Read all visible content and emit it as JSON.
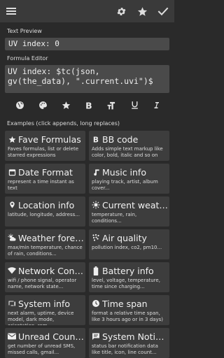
{
  "toolbar": {
    "menu": "hamburger-icon",
    "settings": "gear-icon",
    "favorite": "star-icon",
    "confirm": "check-icon"
  },
  "text_preview": {
    "label": "Text Preview",
    "value": "UV index: 0"
  },
  "formula_editor": {
    "label": "Formula Editor",
    "value": "UV index: $tc(json, gv(the_data), \".current.uvi\")$"
  },
  "editor_tools": [
    "globe-icon",
    "palette-icon",
    "star-icon",
    "bold-icon",
    "text-size-icon",
    "underline-icon",
    "italic-icon"
  ],
  "examples": {
    "label": "Examples",
    "hint": "(click appends, long replaces)",
    "cards": [
      {
        "title": "Fave Formulas",
        "desc": "Faves formulas, list or delete starred expressions",
        "icon": "star-icon"
      },
      {
        "title": "BB code",
        "desc": "Adds simple text markup like color, bold, italic and so on",
        "icon": "bold-icon"
      },
      {
        "title": "Date Format",
        "desc": "represent a time instant as text",
        "icon": "calendar-icon"
      },
      {
        "title": "Music info",
        "desc": "playing track, artist, album cover...",
        "icon": "music-note-icon"
      },
      {
        "title": "Location info",
        "desc": "latitude, longitude, address...",
        "icon": "location-pin-icon"
      },
      {
        "title": "Current weather",
        "desc": "temperature, rain, conditions...",
        "icon": "sun-icon"
      },
      {
        "title": "Weather forec...",
        "desc": "max/min temperature, chance of rain, conditions...",
        "icon": "weather-icon"
      },
      {
        "title": "Air quality",
        "desc": "pollution index, co2, pm10...",
        "icon": "air-quality-icon"
      },
      {
        "title": "Network Conn...",
        "desc": "wifi / phone signal, operator name, network state...",
        "icon": "wifi-icon"
      },
      {
        "title": "Battery info",
        "desc": "level, voltage, temperature, time since charging...",
        "icon": "battery-icon"
      },
      {
        "title": "System info",
        "desc": "next alarm, uptime, device model, dark mode, orientation, rom...",
        "icon": "device-icon"
      },
      {
        "title": "Time span",
        "desc": "format a relative time span, like 3 hours ago or in 3 days)",
        "icon": "clock-icon"
      },
      {
        "title": "Unread Counte...",
        "desc": "get number of unread SMS, missed calls, gmail...",
        "icon": "envelope-icon"
      },
      {
        "title": "System Notific...",
        "desc": "status bar notification data like title, icon, line count...",
        "icon": "chat-icon"
      }
    ]
  }
}
